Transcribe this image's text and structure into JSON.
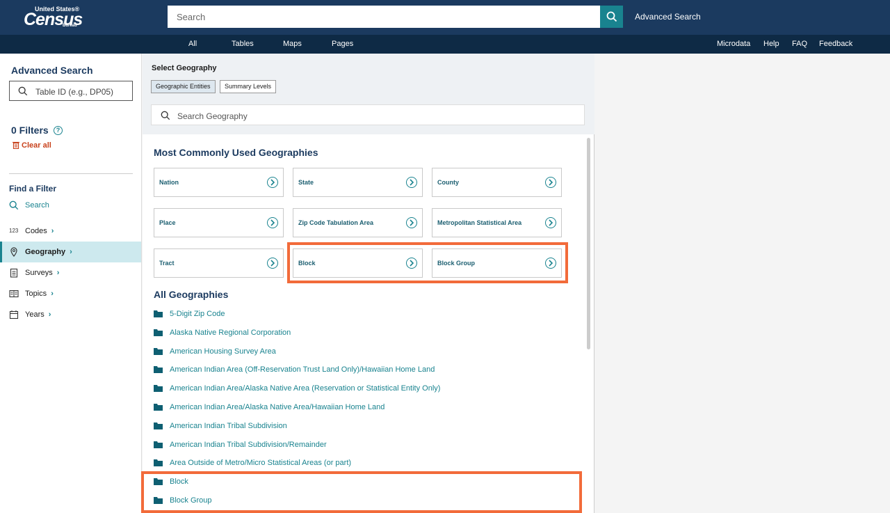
{
  "header": {
    "logo": {
      "line1": "United States®",
      "line2": "Census",
      "line3": "Bureau"
    },
    "search_placeholder": "Search",
    "advanced_search": "Advanced Search"
  },
  "nav": {
    "left": [
      "All",
      "Tables",
      "Maps",
      "Pages"
    ],
    "right": [
      "Microdata",
      "Help",
      "FAQ",
      "Feedback"
    ]
  },
  "sidebar": {
    "title": "Advanced Search",
    "tableid_placeholder": "Table ID (e.g., DP05)",
    "filters": "0 Filters",
    "help_glyph": "?",
    "clear_all": "Clear all",
    "find_filter": "Find a Filter",
    "search_label": "Search",
    "items": [
      {
        "label": "Codes",
        "icon": "codes-123-icon",
        "active": false
      },
      {
        "label": "Geography",
        "icon": "location-pin-icon",
        "active": true
      },
      {
        "label": "Surveys",
        "icon": "clipboard-icon",
        "active": false
      },
      {
        "label": "Topics",
        "icon": "book-icon",
        "active": false
      },
      {
        "label": "Years",
        "icon": "calendar-icon",
        "active": false
      }
    ],
    "codes_glyph": "123"
  },
  "panel": {
    "select_geography": "Select Geography",
    "tabs": [
      "Geographic Entities",
      "Summary Levels"
    ],
    "active_tab": "Geographic Entities",
    "search_placeholder": "Search Geography",
    "common_title": "Most Commonly Used Geographies",
    "common": [
      "Nation",
      "State",
      "County",
      "Place",
      "Zip Code Tabulation Area",
      "Metropolitan Statistical Area",
      "Tract",
      "Block",
      "Block Group"
    ],
    "all_title": "All Geographies",
    "all": [
      "5-Digit Zip Code",
      "Alaska Native Regional Corporation",
      "American Housing Survey Area",
      "American Indian Area (Off-Reservation Trust Land Only)/Hawaiian Home Land",
      "American Indian Area/Alaska Native Area (Reservation or Statistical Entity Only)",
      "American Indian Area/Alaska Native Area/Hawaiian Home Land",
      "American Indian Tribal Subdivision",
      "American Indian Tribal Subdivision/Remainder",
      "Area Outside of Metro/Micro Statistical Areas (or part)",
      "Block",
      "Block Group"
    ]
  },
  "colors": {
    "header": "#1b3a5f",
    "nav": "#0e2a45",
    "teal": "#19838f",
    "highlight": "#f26b3a",
    "clear": "#c8421c"
  }
}
